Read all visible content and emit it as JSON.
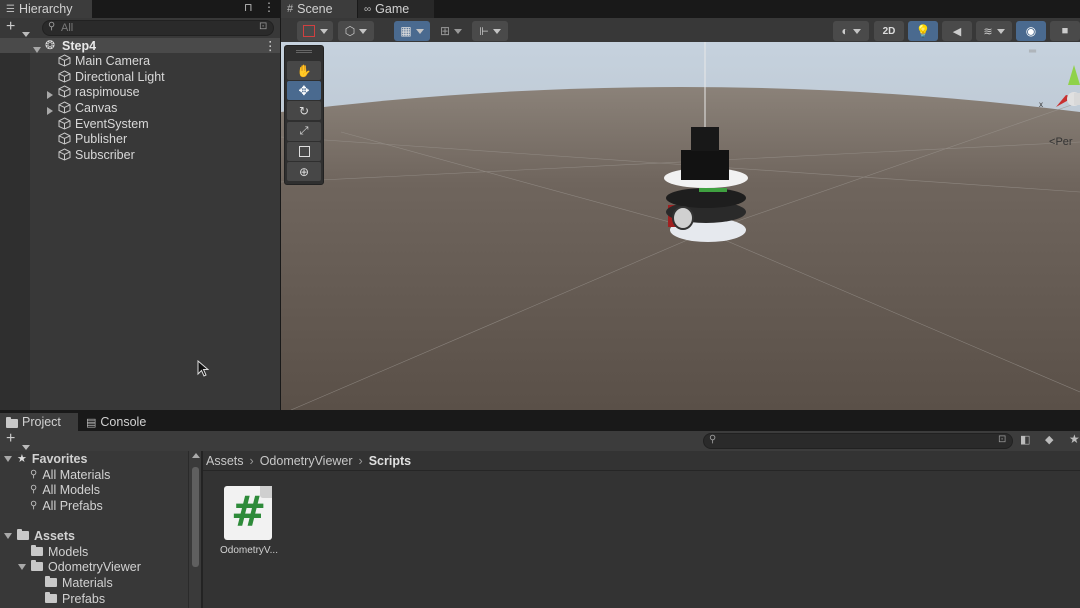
{
  "hierarchy": {
    "tab_label": "Hierarchy",
    "search_placeholder": "All",
    "scene_name": "Step4",
    "items": [
      {
        "label": "Main Camera"
      },
      {
        "label": "Directional Light"
      },
      {
        "label": "raspimouse"
      },
      {
        "label": "Canvas"
      },
      {
        "label": "EventSystem"
      },
      {
        "label": "Publisher"
      },
      {
        "label": "Subscriber"
      }
    ]
  },
  "scene_view": {
    "tabs": [
      {
        "label": "Scene"
      },
      {
        "label": "Game"
      }
    ],
    "toggle_2d_label": "2D",
    "persp_label": "Per",
    "gizmo_axis_label": "x"
  },
  "project": {
    "tabs": [
      {
        "label": "Project"
      },
      {
        "label": "Console"
      }
    ],
    "favorites_label": "Favorites",
    "favorites": [
      {
        "label": "All Materials"
      },
      {
        "label": "All Models"
      },
      {
        "label": "All Prefabs"
      }
    ],
    "assets_label": "Assets",
    "assets_tree": [
      {
        "label": "Models"
      },
      {
        "label": "OdometryViewer"
      },
      {
        "label": "Materials"
      },
      {
        "label": "Prefabs"
      }
    ],
    "breadcrumb": [
      {
        "label": "Assets"
      },
      {
        "label": "OdometryViewer"
      },
      {
        "label": "Scripts"
      }
    ],
    "file": {
      "label": "OdometryV...",
      "glyph": "#"
    }
  },
  "colors": {
    "accent": "#4a6a8f",
    "script_icon": "#2e8b3a"
  }
}
